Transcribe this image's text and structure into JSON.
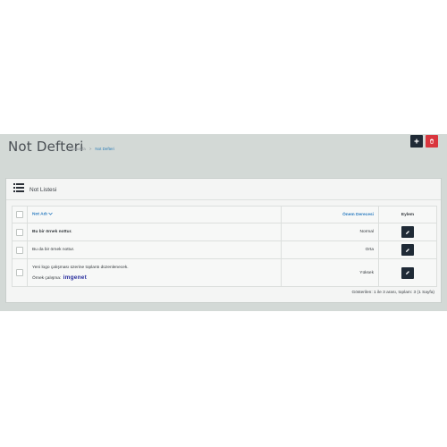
{
  "header": {
    "title": "Not Defteri",
    "breadcrumb": {
      "home": "Anasayfa",
      "separator": ">",
      "current": "Not Defteri"
    },
    "add_icon": "plus-icon",
    "delete_icon": "trash-icon"
  },
  "panel": {
    "icon": "list-icon",
    "title": "Not Listesi"
  },
  "table": {
    "columns": {
      "name": "Not Adı",
      "priority": "Önem Derecesi",
      "action": "Eylem"
    },
    "rows": [
      {
        "name": "Bu bir örnek nottur.",
        "priority": "Normal"
      },
      {
        "name": "Bu da bir örnek nottur.",
        "priority": "Orta"
      },
      {
        "line1": "Yeni logo çalışması üzerine toplantı düzenlenecek.",
        "line2": "Örnek çalışma:",
        "logo": "imgenet",
        "priority": "Yüksek"
      }
    ]
  },
  "pagination": {
    "summary": "Gösterilen: 1 ile 3 arası, toplam: 3 (1 Sayfa)"
  },
  "colors": {
    "background": "#d3d9d6",
    "dark_button": "#1f2a36",
    "danger": "#d9363e",
    "link": "#2b7cc0"
  }
}
